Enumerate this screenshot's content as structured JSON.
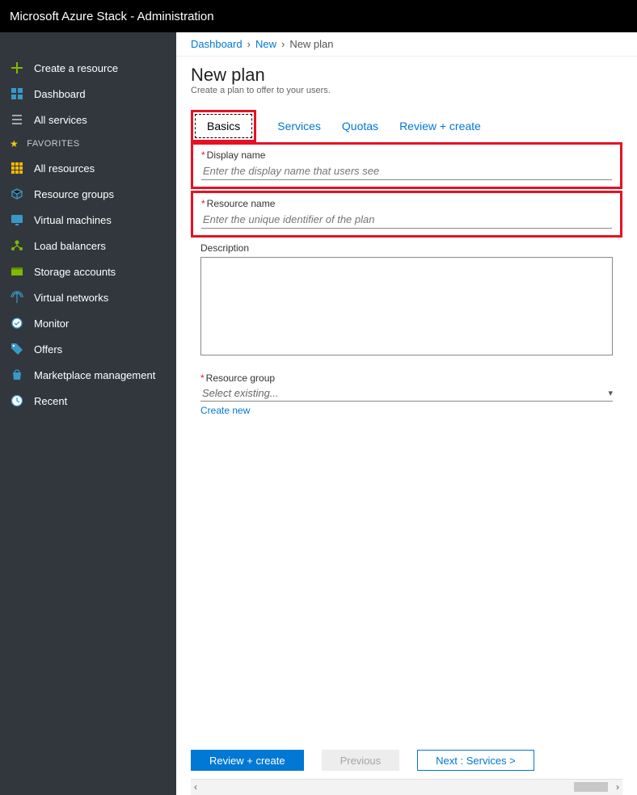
{
  "topbar": {
    "title": "Microsoft Azure Stack - Administration"
  },
  "sidebar": {
    "create": "Create a resource",
    "dashboard": "Dashboard",
    "all_services": "All services",
    "favorites_header": "FAVORITES",
    "items": [
      {
        "label": "All resources"
      },
      {
        "label": "Resource groups"
      },
      {
        "label": "Virtual machines"
      },
      {
        "label": "Load balancers"
      },
      {
        "label": "Storage accounts"
      },
      {
        "label": "Virtual networks"
      },
      {
        "label": "Monitor"
      },
      {
        "label": "Offers"
      },
      {
        "label": "Marketplace management"
      },
      {
        "label": "Recent"
      }
    ]
  },
  "breadcrumb": {
    "l1": "Dashboard",
    "l2": "New",
    "l3": "New plan"
  },
  "page": {
    "title": "New plan",
    "subtitle": "Create a plan to offer to your users."
  },
  "tabs": {
    "basics": "Basics",
    "services": "Services",
    "quotas": "Quotas",
    "review": "Review + create"
  },
  "fields": {
    "display_name_label": "Display name",
    "display_name_placeholder": "Enter the display name that users see",
    "resource_name_label": "Resource name",
    "resource_name_placeholder": "Enter the unique identifier of the plan",
    "description_label": "Description",
    "resource_group_label": "Resource group",
    "resource_group_placeholder": "Select existing...",
    "create_new": "Create new"
  },
  "buttons": {
    "review": "Review + create",
    "previous": "Previous",
    "next": "Next : Services >"
  }
}
